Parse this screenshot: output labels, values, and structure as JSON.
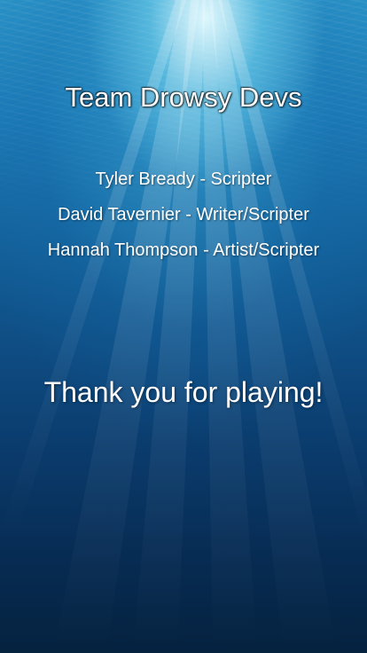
{
  "credits_screen": {
    "title": "Team Drowsy Devs",
    "credits": [
      "Tyler Bready - Scripter",
      "David Tavernier - Writer/Scripter",
      "Hannah Thompson - Artist/Scripter"
    ],
    "closing_message": "Thank you for playing!"
  },
  "colors": {
    "text": "#ffffff",
    "water_top": "#2a93c7",
    "water_bottom": "#05223f",
    "surface_light": "#dcfaff"
  }
}
